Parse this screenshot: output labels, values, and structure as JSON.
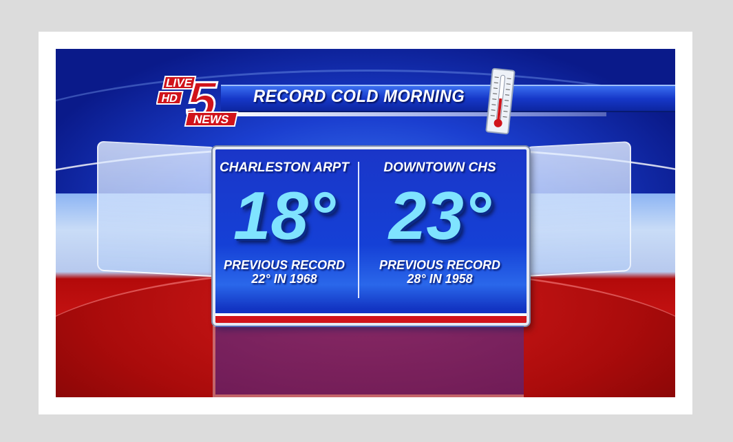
{
  "banner": {
    "title": "RECORD COLD MORNING"
  },
  "logo": {
    "top_text": "LIVE",
    "hd_text": "HD",
    "number": "5",
    "bottom_text": "NEWS"
  },
  "board": {
    "left": {
      "location": "CHARLESTON ARPT",
      "temperature": "18°",
      "record_line1": "PREVIOUS RECORD",
      "record_line2": "22° IN 1968"
    },
    "right": {
      "location": "DOWNTOWN CHS",
      "temperature": "23°",
      "record_line1": "PREVIOUS RECORD",
      "record_line2": "28° IN 1958"
    }
  },
  "colors": {
    "temp_text": "#7fe3ff",
    "banner_blue": "#1638c9",
    "floor_red": "#c51313"
  },
  "icons": [
    "thermometer-icon",
    "station-logo"
  ]
}
